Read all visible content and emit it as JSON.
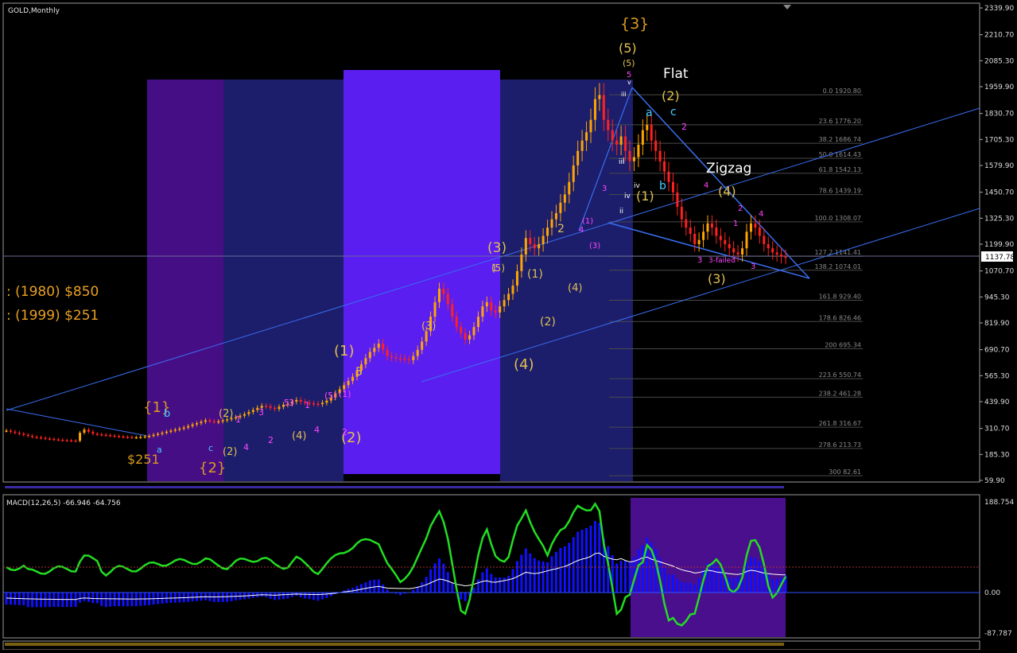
{
  "window": {
    "title": "GOLD,Monthly"
  },
  "chart_data": [
    {
      "type": "line",
      "title": "GOLD,Monthly",
      "price_axis_ticks": [
        "2339.90",
        "2210.70",
        "2085.30",
        "1959.90",
        "1830.70",
        "1705.30",
        "1579.90",
        "1450.70",
        "1325.30",
        "1199.90",
        "1070.70",
        "945.30",
        "819.90",
        "690.70",
        "565.30",
        "439.90",
        "310.70",
        "185.30",
        "59.90"
      ],
      "ylim": [
        59.9,
        2339.9
      ],
      "current_price_label": "1137.78",
      "series": [
        {
          "values": [
            300,
            295,
            290,
            285,
            280,
            275,
            270,
            268,
            265,
            262,
            260,
            258,
            256,
            254,
            253,
            252,
            251,
            290,
            305,
            295,
            285,
            282,
            280,
            278,
            276,
            274,
            272,
            270,
            269,
            268,
            268,
            270,
            272,
            275,
            280,
            285,
            290,
            295,
            300,
            305,
            310,
            315,
            322,
            330,
            336,
            343,
            350,
            346,
            342,
            345,
            350,
            355,
            360,
            365,
            372,
            380,
            390,
            400,
            410,
            420,
            418,
            410,
            405,
            415,
            425,
            430,
            440,
            448,
            440,
            435,
            432,
            430,
            428,
            435,
            445,
            460,
            480,
            500,
            520,
            540,
            560,
            590,
            620,
            650,
            680,
            700,
            720,
            690,
            660,
            655,
            650,
            648,
            645,
            640,
            660,
            690,
            730,
            780,
            850,
            920,
            985,
            960,
            910,
            850,
            800,
            770,
            740,
            760,
            800,
            850,
            900,
            920,
            880,
            870,
            900,
            930,
            960,
            1000,
            1070,
            1150,
            1230,
            1200,
            1180,
            1200,
            1240,
            1280,
            1320,
            1350,
            1400,
            1440,
            1500,
            1580,
            1650,
            1700,
            1740,
            1800,
            1900,
            1920,
            1800,
            1750,
            1700,
            1680,
            1720,
            1650,
            1600,
            1620,
            1680,
            1750,
            1776,
            1700,
            1650,
            1600,
            1550,
            1500,
            1450,
            1380,
            1320,
            1280,
            1250,
            1200,
            1220,
            1260,
            1300,
            1280,
            1240,
            1220,
            1200,
            1180,
            1160,
            1150,
            1180,
            1260,
            1300,
            1280,
            1240,
            1200,
            1180,
            1160,
            1150,
            1140,
            1137
          ]
        }
      ],
      "fib_levels": [
        {
          "label": "0.0 1920.80",
          "value": 1920.8
        },
        {
          "label": "23.6 1776.20",
          "value": 1776.2
        },
        {
          "label": "38.2 1686.74",
          "value": 1686.74
        },
        {
          "label": "50.0 1614.43",
          "value": 1614.43
        },
        {
          "label": "61.8 1542.13",
          "value": 1542.13
        },
        {
          "label": "78.6 1439.19",
          "value": 1439.19
        },
        {
          "label": "100.0 1308.07",
          "value": 1308.07
        },
        {
          "label": "127.2 1141.41",
          "value": 1141.41
        },
        {
          "label": "138.2 1074.01",
          "value": 1074.01
        },
        {
          "label": "161.8 929.40",
          "value": 929.4
        },
        {
          "label": "178.6 826.46",
          "value": 826.46
        },
        {
          "label": "200 695.34",
          "value": 695.34
        },
        {
          "label": "223.6 550.74",
          "value": 550.74
        },
        {
          "label": "238.2 461.28",
          "value": 461.28
        },
        {
          "label": "261.8 316.67",
          "value": 316.67
        },
        {
          "label": "278.6 213.73",
          "value": 213.73
        },
        {
          "label": "300 82.61",
          "value": 82.61
        }
      ],
      "annotations": {
        "price_history": [
          ": (1980) $850",
          ": (1999) $251"
        ],
        "pattern_labels": [
          "Flat",
          "Zigzag"
        ],
        "wave_labels": [
          "{3}",
          "(5)",
          "(5)",
          "5",
          "v",
          "iii",
          "(2)",
          "a",
          "c",
          "2",
          "(1)",
          "iv",
          "b",
          "ii",
          "iii",
          "i",
          "iv",
          "3",
          "(4)",
          "4",
          "2",
          "4",
          "1",
          "3",
          "3-failed",
          "3",
          "(3)",
          "(3)",
          "(5)",
          "(1)",
          "(2)",
          "(4)",
          "(1)",
          "(3)",
          "4",
          "2",
          "1",
          "(1)",
          "(5)",
          "5",
          "3",
          "1",
          "4",
          "(2)",
          "(3)",
          "5",
          "3",
          "1",
          "(4)",
          "2",
          "(1)",
          "(2)",
          "2",
          "4",
          "c",
          "{1}",
          "b",
          "a",
          "$251",
          "{2}",
          "(2)",
          "(4)"
        ]
      }
    },
    {
      "type": "line",
      "title": "MACD(12,26,5) -66.946 -64.756",
      "ticks": [
        "188.754",
        "0.00",
        "-87.787"
      ],
      "series": []
    }
  ],
  "colors": {
    "background": "#000000",
    "candle_up": "#ffa500",
    "candle_down": "#ff2020",
    "trendline": "#3a6df0",
    "macd_signal": "#22dd22",
    "histogram": "#1010ff",
    "wave_yellow": "#e0c050",
    "wave_magenta": "#ff44ff",
    "wave_cyan": "#44ccff"
  }
}
